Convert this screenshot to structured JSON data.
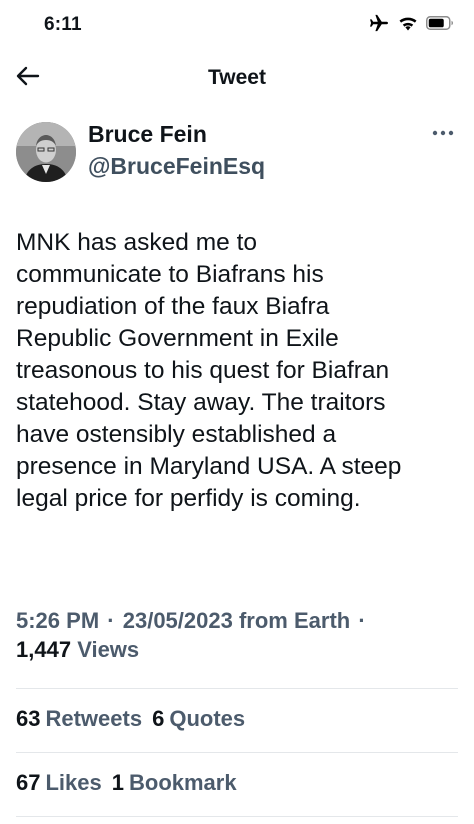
{
  "status_bar": {
    "time": "6:11",
    "icons": [
      "airplane-icon",
      "wifi-icon",
      "battery-icon"
    ]
  },
  "nav": {
    "title": "Tweet",
    "back_icon": "back-arrow-icon"
  },
  "author": {
    "name": "Bruce Fein",
    "handle": "@BruceFeinEsq",
    "more_icon": "more-options-icon"
  },
  "tweet": {
    "text": "MNK has asked me to\ncommunicate to Biafrans his\nrepudiation of the faux Biafra\nRepublic Government in Exile\ntreasonous to his quest for Biafran\nstatehood. Stay away. The traitors\nhave ostensibly established a\npresence in Maryland USA. A steep\nlegal price for perfidy is coming."
  },
  "meta": {
    "time": "5:26 PM",
    "date": "23/05/2023",
    "source": "from Earth",
    "separator": "·"
  },
  "views": {
    "count": "1,447",
    "label": "Views"
  },
  "engagement": {
    "retweets": {
      "count": "63",
      "label": "Retweets"
    },
    "quotes": {
      "count": "6",
      "label": "Quotes"
    },
    "likes": {
      "count": "67",
      "label": "Likes"
    },
    "bookmarks": {
      "count": "1",
      "label": "Bookmark"
    }
  },
  "colors": {
    "text": "#0f1419",
    "secondary": "#4c5b6c",
    "divider": "#e4e7ea"
  }
}
